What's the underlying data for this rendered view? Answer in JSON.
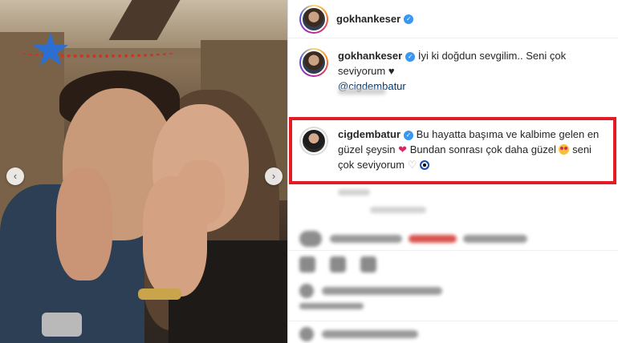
{
  "post": {
    "author": "gokhankeser",
    "nav_prev_icon": "‹",
    "nav_next_icon": "›"
  },
  "caption": {
    "username": "gokhankeser",
    "text": "İyi ki doğdun sevgilim.. Seni çok seviyorum",
    "heart": "♥",
    "mention": "@cigdembatur"
  },
  "highlighted_comment": {
    "username": "cigdembatur",
    "text_part1": "Bu hayatta başıma ve kalbime gelen en güzel şeysin",
    "red_heart": "❤",
    "text_part2": "Bundan sonrası çok daha güzel",
    "text_part3": "seni çok seviyorum",
    "white_heart": "♡"
  },
  "colors": {
    "highlight_border": "#e31b23",
    "verified": "#3897f0",
    "mention": "#00376b"
  }
}
